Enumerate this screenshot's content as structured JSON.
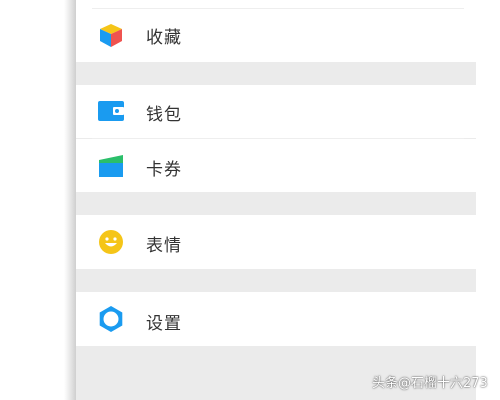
{
  "menu": {
    "favorites": {
      "label": "收藏",
      "icon": "cube-icon"
    },
    "wallet": {
      "label": "钱包",
      "icon": "wallet-icon"
    },
    "cards": {
      "label": "卡券",
      "icon": "card-icon"
    },
    "stickers": {
      "label": "表情",
      "icon": "smiley-icon"
    },
    "settings": {
      "label": "设置",
      "icon": "gear-icon"
    }
  },
  "colors": {
    "divider_gap": "#ebebeb",
    "accent_blue": "#1a9bf0",
    "accent_green": "#2bbf6a",
    "accent_yellow": "#f5c518",
    "accent_red": "#ef5350"
  },
  "watermark": {
    "text": "头条@石榴十六273"
  }
}
